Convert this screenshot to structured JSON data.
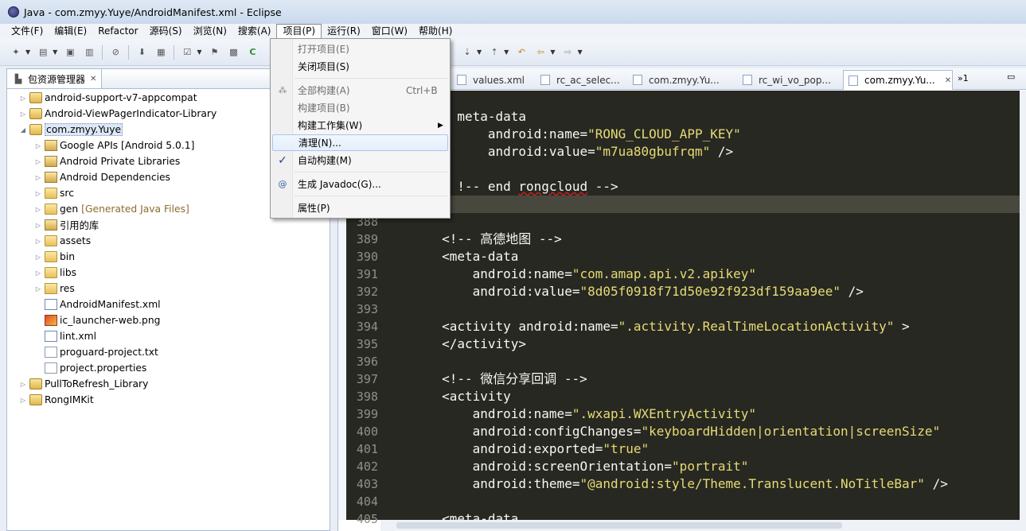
{
  "window": {
    "title": "Java  -  com.zmyy.Yuye/AndroidManifest.xml  -  Eclipse"
  },
  "menubar": {
    "items": [
      "文件(F)",
      "编辑(E)",
      "Refactor",
      "源码(S)",
      "浏览(N)",
      "搜索(A)",
      "项目(P)",
      "运行(R)",
      "窗口(W)",
      "帮助(H)"
    ],
    "active": "项目(P)"
  },
  "project_menu": {
    "open_project": "打开项目(E)",
    "close_project": "关闭项目(S)",
    "build_all": "全部构建(A)",
    "build_all_shortcut": "Ctrl+B",
    "build_project": "构建项目(B)",
    "build_working_set": "构建工作集(W)",
    "clean": "清理(N)...",
    "build_automatically": "自动构建(M)",
    "generate_javadoc": "生成 Javadoc(G)...",
    "properties": "属性(P)"
  },
  "explorer": {
    "tab_label": "包资源管理器",
    "items": [
      {
        "label": "android-support-v7-appcompat",
        "sub": ""
      },
      {
        "label": "Android-ViewPagerIndicator-Library",
        "sub": ""
      },
      {
        "label": "com.zmyy.Yuye",
        "sub": ""
      },
      {
        "label": "Google APIs [Android 5.0.1]",
        "sub": ""
      },
      {
        "label": "Android Private Libraries",
        "sub": ""
      },
      {
        "label": "Android Dependencies",
        "sub": ""
      },
      {
        "label": "src",
        "sub": ""
      },
      {
        "label": "gen",
        "sub": "[Generated Java Files]"
      },
      {
        "label": "引用的库",
        "sub": ""
      },
      {
        "label": "assets",
        "sub": ""
      },
      {
        "label": "bin",
        "sub": ""
      },
      {
        "label": "libs",
        "sub": ""
      },
      {
        "label": "res",
        "sub": ""
      },
      {
        "label": "AndroidManifest.xml",
        "sub": ""
      },
      {
        "label": "ic_launcher-web.png",
        "sub": ""
      },
      {
        "label": "lint.xml",
        "sub": ""
      },
      {
        "label": "proguard-project.txt",
        "sub": ""
      },
      {
        "label": "project.properties",
        "sub": ""
      },
      {
        "label": "PullToRefresh_Library",
        "sub": ""
      },
      {
        "label": "RongIMKit",
        "sub": ""
      }
    ]
  },
  "editor": {
    "tabs": [
      "values.xml",
      "rc_ac_selec...",
      "com.zmyy.Yu...",
      "rc_wi_vo_pop...",
      "com.zmyy.Yu..."
    ],
    "overflow": "»1",
    "line_numbers": [
      "388",
      "389",
      "390",
      "391",
      "392",
      "393",
      "394",
      "395",
      "396",
      "397",
      "398",
      "399",
      "400",
      "401",
      "402",
      "403",
      "404",
      "405"
    ],
    "code": {
      "l0_tag": "meta-data",
      "l1_attr": "android:name=",
      "l1_val": "\"RONG_CLOUD_APP_KEY\"",
      "l2_attr": "android:value=",
      "l2_val": "\"m7ua80gbufrqm\"",
      "l2_end": " />",
      "l4_pre": "!-- end ",
      "l4_word": "rongcloud",
      "l4_post": " -->",
      "l7": "<!-- 高德地图 -->",
      "l8": "<meta-data",
      "l9_attr": "android:name=",
      "l9_val": "\"com.amap.api.v2.apikey\"",
      "l10_attr": "android:value=",
      "l10_val": "\"8d05f0918f71d50e92f923df159aa9ee\"",
      "l10_end": " />",
      "l12_pre": "<activity android:name=",
      "l12_val": "\".activity.RealTimeLocationActivity\"",
      "l12_end": " >",
      "l13": "</activity>",
      "l15": "<!-- 微信分享回调 -->",
      "l16": "<activity",
      "l17_attr": "android:name=",
      "l17_val": "\".wxapi.WXEntryActivity\"",
      "l18_attr": "android:configChanges=",
      "l18_val": "\"keyboardHidden|orientation|screenSize\"",
      "l19_attr": "android:exported=",
      "l19_val": "\"true\"",
      "l20_attr": "android:screenOrientation=",
      "l20_val": "\"portrait\"",
      "l21_attr": "android:theme=",
      "l21_val": "\"@android:style/Theme.Translucent.NoTitleBar\"",
      "l21_end": " />",
      "l23": "<meta-data"
    }
  },
  "colors": {
    "editor_bg": "#272822",
    "string": "#e6db74",
    "current_line": "#49483e"
  }
}
